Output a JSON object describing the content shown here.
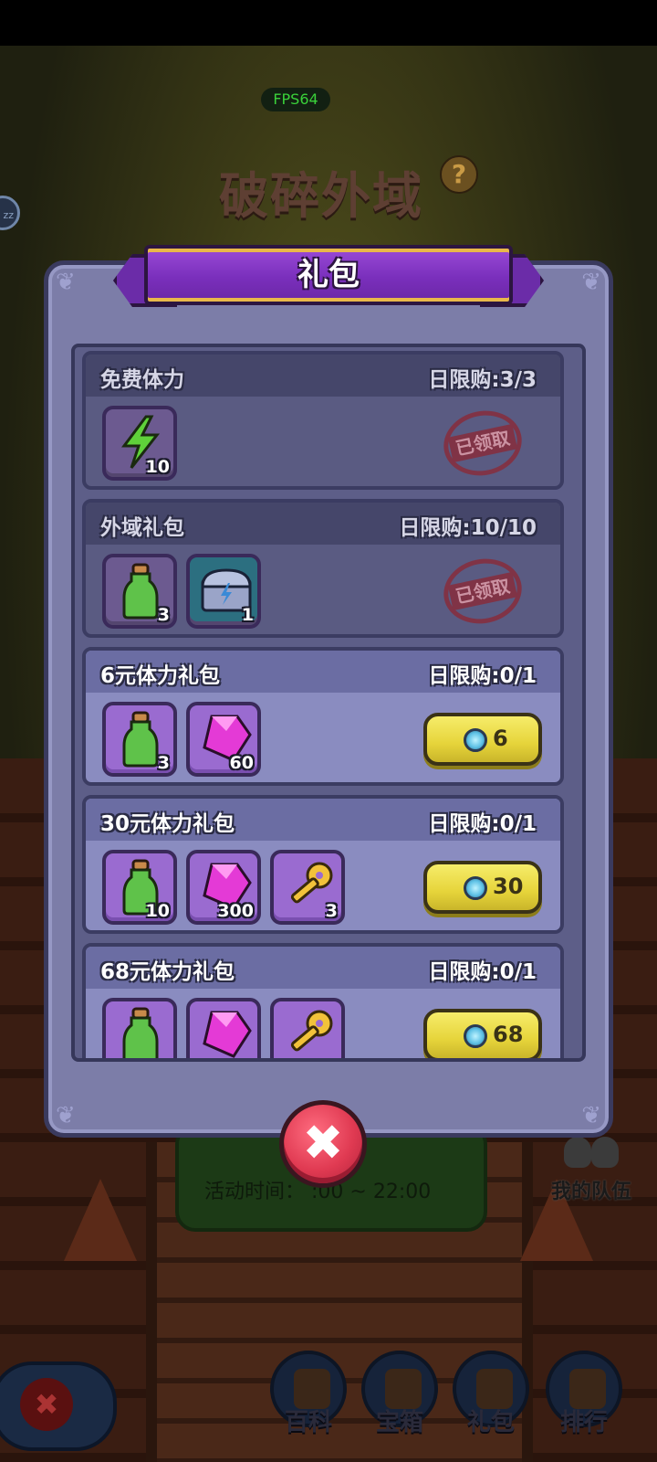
{
  "hud": {
    "fps": "FPS64",
    "zone_title": "破碎外域",
    "help": "?",
    "side_bubble": "zz",
    "activity_time": "活动时间：  :00 ~ 22:00",
    "team_label": "我的队伍"
  },
  "bottom_nav": [
    {
      "label": "百科",
      "icon": "book-icon"
    },
    {
      "label": "宝箱",
      "icon": "chest-icon"
    },
    {
      "label": "礼包",
      "icon": "bag-icon"
    },
    {
      "label": "排行",
      "icon": "trophy-icon"
    }
  ],
  "dialog": {
    "title": "礼包",
    "close_symbol": "✖",
    "packages": [
      {
        "name": "免费体力",
        "limit": "日限购:3/3",
        "claimed": true,
        "stamp": "已领取",
        "items": [
          {
            "icon": "lightning-icon",
            "qty": "10"
          }
        ]
      },
      {
        "name": "外域礼包",
        "limit": "日限购:10/10",
        "claimed": true,
        "stamp": "已领取",
        "items": [
          {
            "icon": "potion-icon",
            "qty": "3"
          },
          {
            "icon": "chest-icon",
            "qty": "1"
          }
        ]
      },
      {
        "name": "6元体力礼包",
        "limit": "日限购:0/1",
        "claimed": false,
        "price": "6",
        "items": [
          {
            "icon": "potion-icon",
            "qty": "3"
          },
          {
            "icon": "gem-icon",
            "qty": "60"
          }
        ]
      },
      {
        "name": "30元体力礼包",
        "limit": "日限购:0/1",
        "claimed": false,
        "price": "30",
        "items": [
          {
            "icon": "potion-icon",
            "qty": "10"
          },
          {
            "icon": "gem-icon",
            "qty": "300"
          },
          {
            "icon": "key-icon",
            "qty": "3"
          }
        ]
      },
      {
        "name": "68元体力礼包",
        "limit": "日限购:0/1",
        "claimed": false,
        "price": "68",
        "items": [
          {
            "icon": "potion-icon",
            "qty": ""
          },
          {
            "icon": "gem-icon",
            "qty": ""
          },
          {
            "icon": "key-icon",
            "qty": ""
          }
        ]
      }
    ]
  },
  "colors": {
    "panel": "#7c7da8",
    "ribbon": "#7a2fbc",
    "buy_button": "#e6d43a",
    "close_button": "#e03a52",
    "stamp": "#c43d4e"
  }
}
